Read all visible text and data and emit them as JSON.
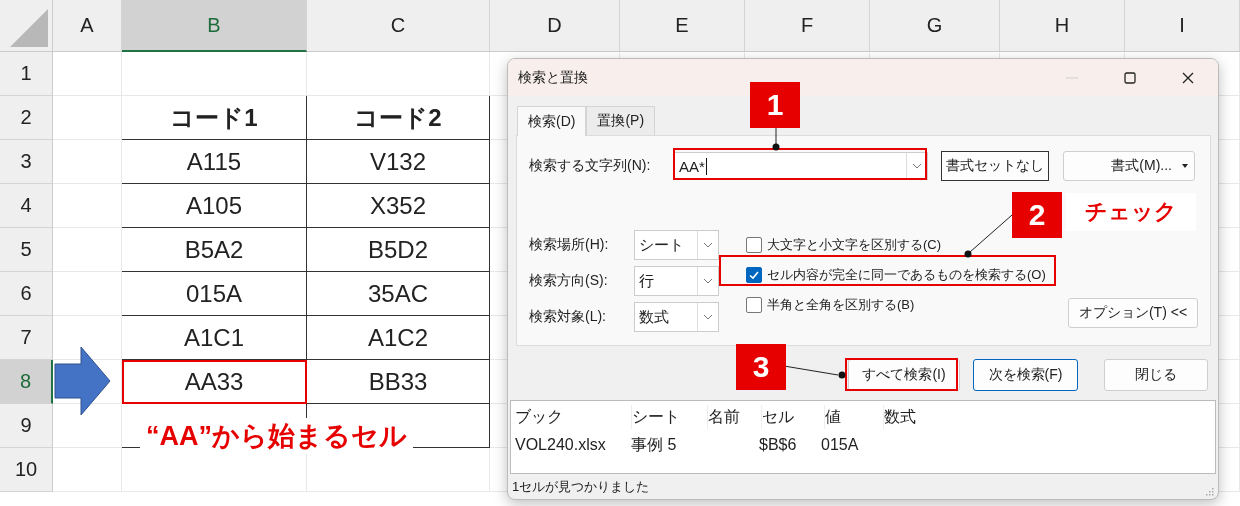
{
  "sheet": {
    "columns": [
      {
        "label": "A",
        "selected": false
      },
      {
        "label": "B",
        "selected": true
      },
      {
        "label": "C",
        "selected": false
      },
      {
        "label": "D",
        "selected": false
      },
      {
        "label": "E",
        "selected": false
      },
      {
        "label": "F",
        "selected": false
      },
      {
        "label": "G",
        "selected": false
      },
      {
        "label": "H",
        "selected": false
      },
      {
        "label": "I",
        "selected": false
      }
    ],
    "rows": [
      {
        "label": "1",
        "selected": false
      },
      {
        "label": "2",
        "selected": false
      },
      {
        "label": "3",
        "selected": false
      },
      {
        "label": "4",
        "selected": false
      },
      {
        "label": "5",
        "selected": false
      },
      {
        "label": "6",
        "selected": false
      },
      {
        "label": "7",
        "selected": false
      },
      {
        "label": "8",
        "selected": true
      },
      {
        "label": "9",
        "selected": false
      },
      {
        "label": "10",
        "selected": false
      }
    ],
    "table": {
      "header": [
        "コード1",
        "コード2"
      ],
      "rows": [
        [
          "A115",
          "V132"
        ],
        [
          "A105",
          "X352"
        ],
        [
          "B5A2",
          "B5D2"
        ],
        [
          "015A",
          "35AC"
        ],
        [
          "A1C1",
          "A1C2"
        ],
        [
          "AA33",
          "BB33"
        ]
      ]
    }
  },
  "dialog": {
    "title": "検索と置換",
    "tabs": [
      {
        "label": "検索(D)",
        "selected": true
      },
      {
        "label": "置換(P)",
        "selected": false
      }
    ],
    "find_what": {
      "label": "検索する文字列(N):",
      "value": "AA*"
    },
    "format_buttons": [
      "書式セットなし",
      "書式(M)..."
    ],
    "options": [
      {
        "label": "検索場所(H):",
        "value": "シート"
      },
      {
        "label": "検索方向(S):",
        "value": "行"
      },
      {
        "label": "検索対象(L):",
        "value": "数式"
      }
    ],
    "checkboxes": [
      {
        "label": "大文字と小文字を区別する(C)",
        "checked": false
      },
      {
        "label": "セル内容が完全に同一であるものを検索する(O)",
        "checked": true
      },
      {
        "label": "半角と全角を区別する(B)",
        "checked": false
      }
    ],
    "options_button": "オプション(T) <<",
    "buttons": [
      "すべて検索(I)",
      "次を検索(F)",
      "閉じる"
    ],
    "results": {
      "columns": [
        "ブック",
        "シート",
        "名前",
        "セル",
        "値",
        "数式"
      ],
      "rows": [
        {
          "book": "VOL240.xlsx",
          "sheet": "事例 5",
          "cell": "$B$6",
          "value": "015A"
        }
      ]
    },
    "status": "1セルが見つかりました"
  },
  "annotations": {
    "steps": [
      "1",
      "2",
      "3"
    ],
    "check_note": "チェック",
    "caption": "“AA”から始まるセル"
  }
}
